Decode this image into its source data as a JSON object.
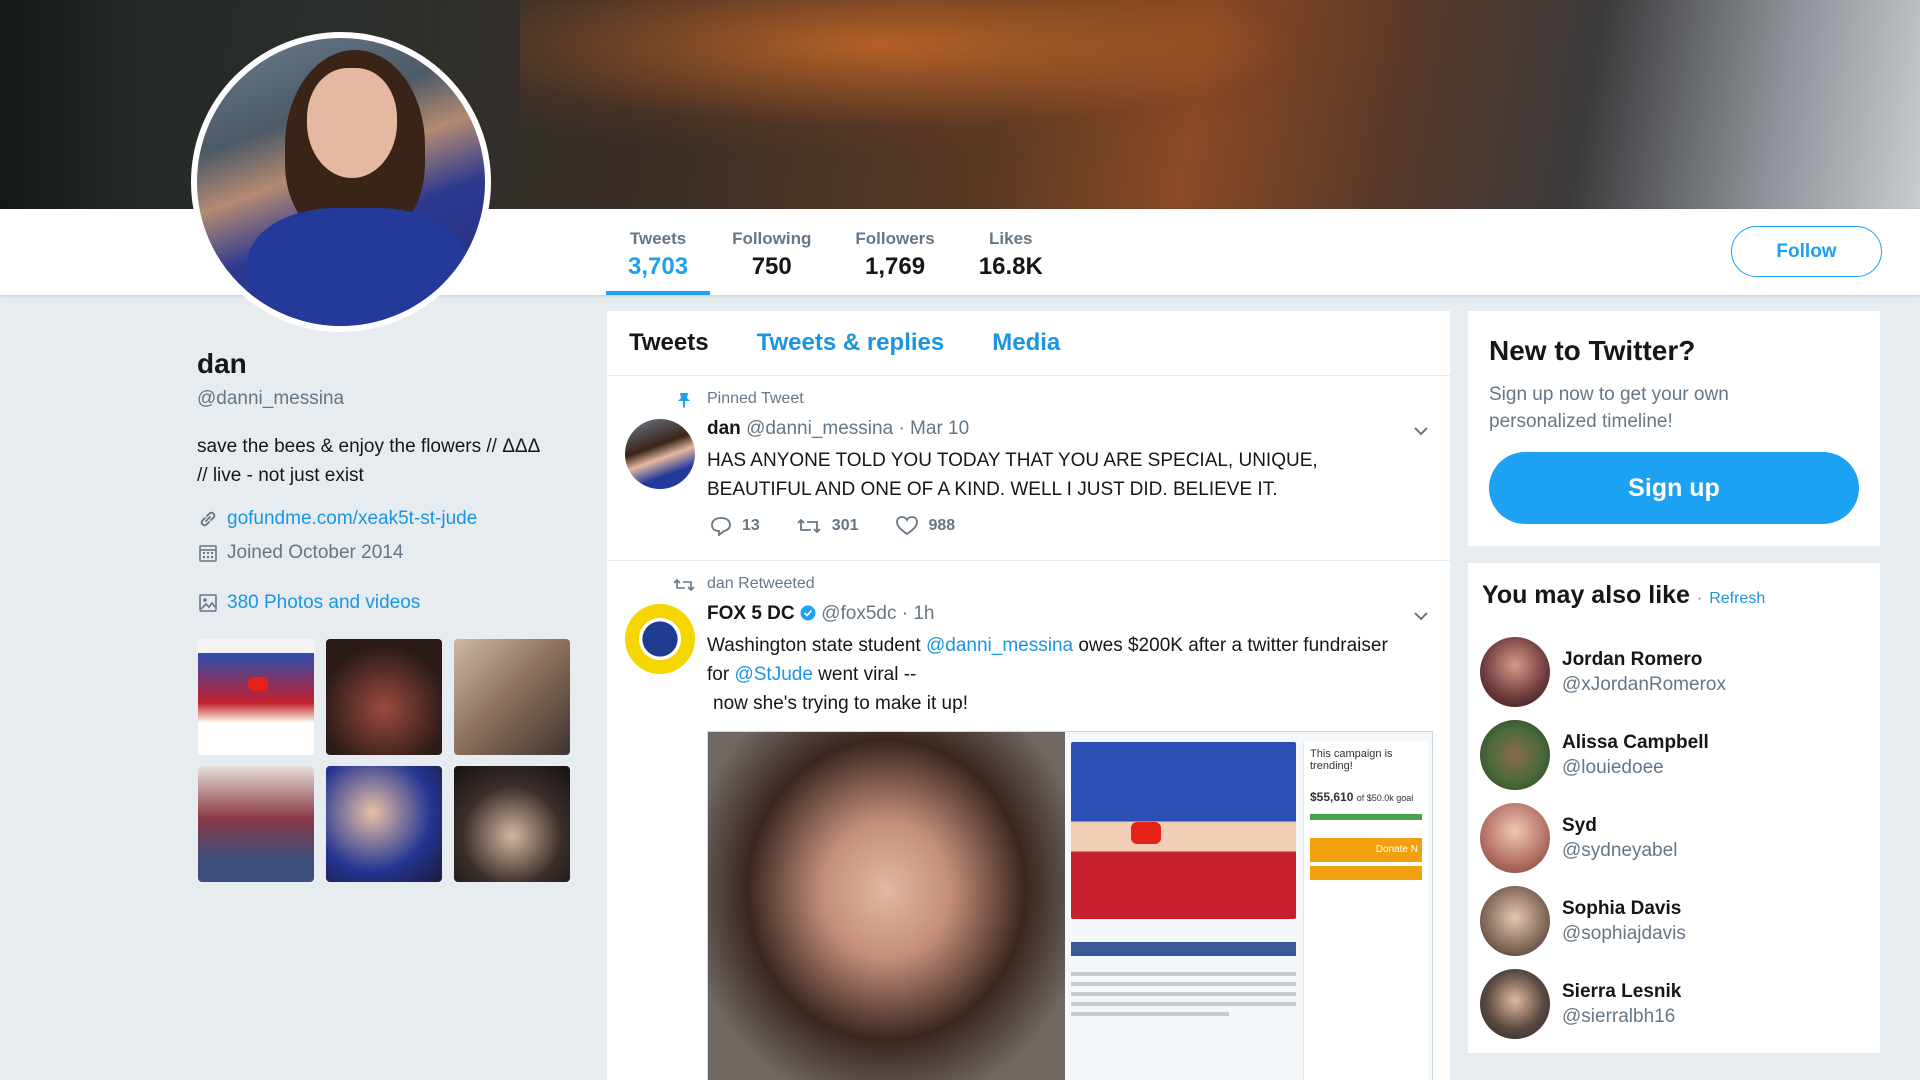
{
  "profile": {
    "name": "dan",
    "handle": "@danni_messina",
    "bio_line1": "save the bees & enjoy the flowers // ΔΔΔ",
    "bio_line2": "// live - not just exist",
    "website": "gofundme.com/xeak5t-st-jude",
    "joined": "Joined October 2014",
    "media_link": "380 Photos and videos"
  },
  "stats": [
    {
      "label": "Tweets",
      "value": "3,703"
    },
    {
      "label": "Following",
      "value": "750"
    },
    {
      "label": "Followers",
      "value": "1,769"
    },
    {
      "label": "Likes",
      "value": "16.8K"
    }
  ],
  "follow_label": "Follow",
  "timeline_tabs": [
    "Tweets",
    "Tweets & replies",
    "Media"
  ],
  "tweets": [
    {
      "context": "Pinned Tweet",
      "name": "dan",
      "handle": "@danni_messina",
      "time": "· Mar 10",
      "text_line1": "HAS ANYONE TOLD YOU TODAY THAT YOU ARE SPECIAL, UNIQUE,",
      "text_line2": "BEAUTIFUL AND ONE OF A KIND. WELL I JUST DID. BELIEVE IT.",
      "replies": "13",
      "retweets": "301",
      "likes": "988"
    },
    {
      "context": "dan Retweeted",
      "name": "FOX 5 DC",
      "handle": "@fox5dc",
      "time": "· 1h",
      "text_pre": "Washington state student ",
      "mention": "@danni_messina",
      "text_mid": " owes $200K after a twitter fundraiser",
      "text_for": "for ",
      "mention2": "@StJude",
      "text_post": " went viral --",
      "text_line3": "now she's trying to make it up!",
      "media_amount": "$55,610",
      "media_goal": "of $50.0k goal",
      "media_trending": "This campaign is trending!",
      "media_donate": "Donate N"
    }
  ],
  "new_to_twitter": {
    "title": "New to Twitter?",
    "sub_line1": "Sign up now to get your own",
    "sub_line2": "personalized timeline!",
    "button": "Sign up"
  },
  "who_to_follow": {
    "title": "You may also like",
    "separator": "·",
    "refresh": "Refresh",
    "users": [
      {
        "name": "Jordan Romero",
        "handle": "@xJordanRomerox",
        "color": "#6b3a3a"
      },
      {
        "name": "Alissa Campbell",
        "handle": "@louiedoee",
        "color": "#4a6a3a"
      },
      {
        "name": "Syd",
        "handle": "@sydneyabel",
        "color": "#b8766a"
      },
      {
        "name": "Sophia Davis",
        "handle": "@sophiajdavis",
        "color": "#8a7060"
      },
      {
        "name": "Sierra Lesnik",
        "handle": "@sierralbh16",
        "color": "#5a4a40"
      }
    ]
  },
  "colors": {
    "accent": "#1da1f2",
    "link": "#1b95e0",
    "background": "#e6ecf0"
  }
}
